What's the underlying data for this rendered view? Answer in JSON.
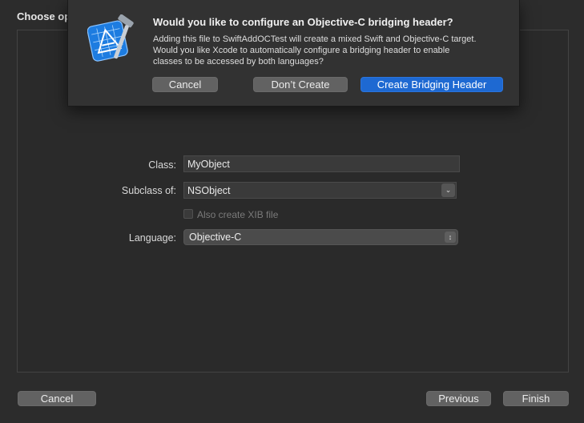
{
  "window": {
    "title": "Choose op"
  },
  "form": {
    "class_label": "Class:",
    "class_value": "MyObject",
    "subclass_label": "Subclass of:",
    "subclass_value": "NSObject",
    "xib_label": "Also create XIB file",
    "xib_checked": false,
    "xib_enabled": false,
    "language_label": "Language:",
    "language_value": "Objective-C"
  },
  "footer": {
    "cancel_label": "Cancel",
    "previous_label": "Previous",
    "finish_label": "Finish"
  },
  "dialog": {
    "title": "Would you like to configure an Objective-C bridging header?",
    "message": "Adding this file to SwiftAddOCTest will create a mixed Swift and Objective-C target. Would you like Xcode to automatically configure a bridging header to enable classes to be accessed by both languages?",
    "cancel_label": "Cancel",
    "dont_create_label": "Don’t Create",
    "create_label": "Create Bridging Header",
    "icon": "xcode-app-icon"
  },
  "colors": {
    "accent": "#1e69d2",
    "background": "#2c2c2c",
    "sheet": "#323232"
  }
}
